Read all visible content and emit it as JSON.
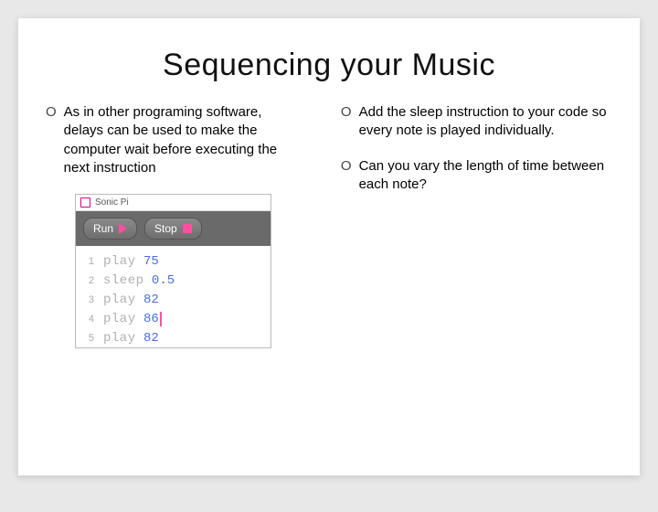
{
  "title": "Sequencing your Music",
  "left_bullets": [
    "As in other programing software, delays can be used to make the computer wait before executing the next instruction"
  ],
  "right_bullets": [
    "Add the sleep instruction to your code so every note is played individually.",
    "Can you vary the length of time between each note?"
  ],
  "app": {
    "title": "Sonic Pi",
    "run_label": "Run",
    "stop_label": "Stop"
  },
  "code": {
    "lines": [
      {
        "n": "1",
        "kw": "play",
        "val": "75"
      },
      {
        "n": "2",
        "kw": "sleep",
        "val": "0.5"
      },
      {
        "n": "3",
        "kw": "play",
        "val": "82"
      },
      {
        "n": "4",
        "kw": "play",
        "val": "86",
        "cursor": true
      },
      {
        "n": "5",
        "kw": "play",
        "val": "82"
      }
    ]
  }
}
